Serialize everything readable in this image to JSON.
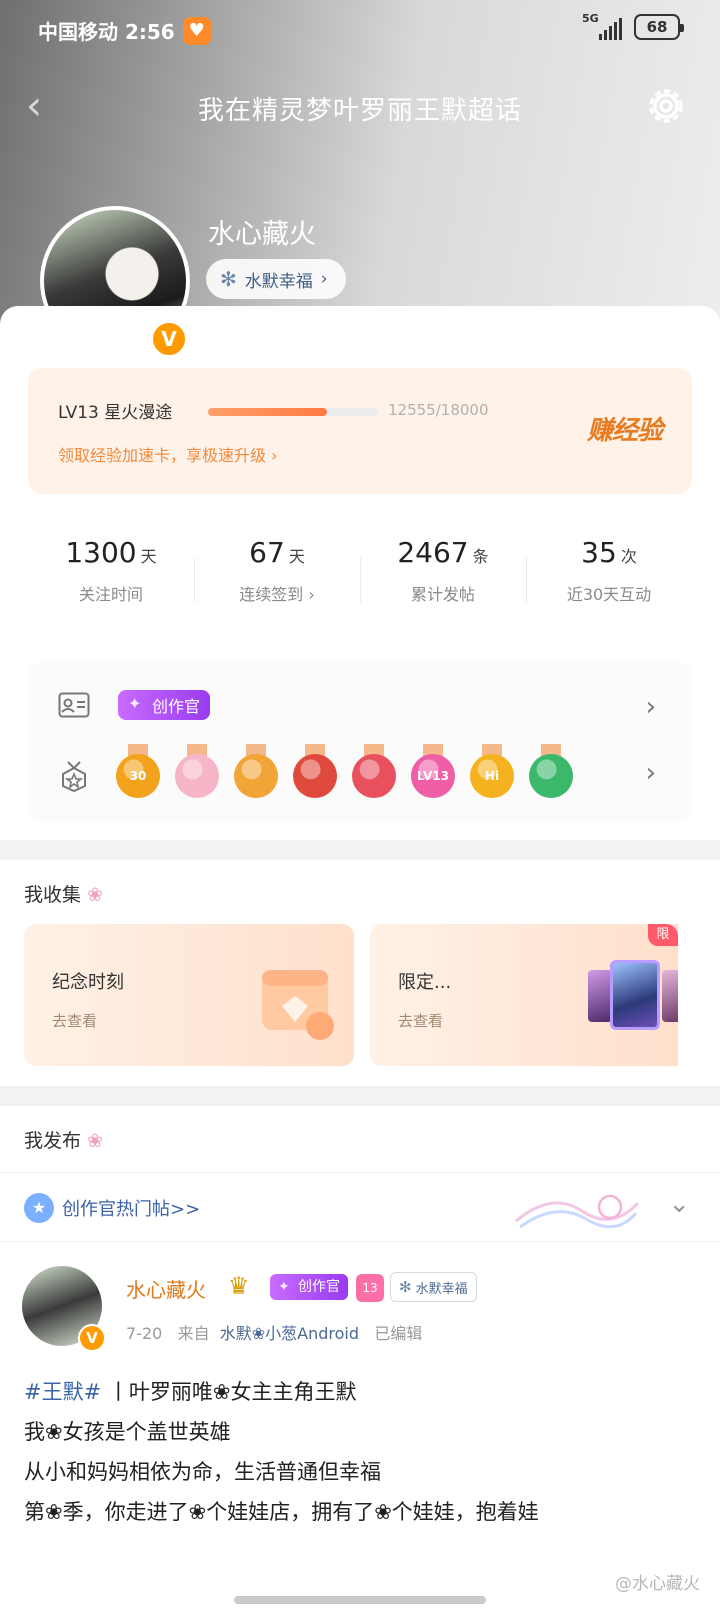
{
  "status": {
    "carrier_time": "中国移动 2:56",
    "network": "5G",
    "battery": "68"
  },
  "header": {
    "title": "我在精灵梦叶罗丽王默超话"
  },
  "profile": {
    "name": "水心藏火",
    "group": "水默幸福",
    "verified": "V"
  },
  "level": {
    "label": "LV13 星火漫途",
    "progress_text": "12555/18000",
    "progress_fraction": 0.6975,
    "hint": "领取经验加速卡，享极速升级",
    "earn": "赚经验"
  },
  "stats": [
    {
      "num": "1300",
      "unit": "天",
      "label": "关注时间"
    },
    {
      "num": "67",
      "unit": "天",
      "label": "连续签到"
    },
    {
      "num": "2467",
      "unit": "条",
      "label": "累计发帖"
    },
    {
      "num": "35",
      "unit": "次",
      "label": "近30天互动"
    }
  ],
  "badges": {
    "creator_tag": "创作官",
    "medals": [
      {
        "icon": "30-days-medal",
        "text": "30",
        "color": "#f2a21b"
      },
      {
        "icon": "sakura-medal",
        "text": "",
        "color": "#f6b6c8"
      },
      {
        "icon": "crown-medal",
        "text": "",
        "color": "#f2a436"
      },
      {
        "icon": "cat-medal-red",
        "text": "",
        "color": "#e04a3c"
      },
      {
        "icon": "cat-medal-pink",
        "text": "",
        "color": "#e8505e"
      },
      {
        "icon": "lv13-medal",
        "text": "LV13",
        "color": "#f05ea7"
      },
      {
        "icon": "hi-medal",
        "text": "Hi",
        "color": "#f6b21e"
      },
      {
        "icon": "hand-medal",
        "text": "",
        "color": "#3bb86a"
      }
    ]
  },
  "collection": {
    "title": "我收集",
    "cards": [
      {
        "name": "纪念时刻",
        "go": "去查看"
      },
      {
        "name": "限定...",
        "go": "去查看",
        "tag": "限"
      }
    ]
  },
  "posts": {
    "title": "我发布",
    "hot_label": "创作官热门帖>>",
    "post": {
      "author": "水心藏火",
      "creator_tag": "创作官",
      "level": "13",
      "group": "水默幸福",
      "date": "7-20",
      "from_label": "来自",
      "source": "水默❀小葱Android",
      "edited": "已编辑",
      "hashtag": "#王默#",
      "lines": [
        "丨叶罗丽唯❀女主主角王默",
        "我❀女孩是个盖世英雄",
        "从小和妈妈相依为命，生活普通但幸福",
        "第❀季，你走进了❀个娃娃店，拥有了❀个娃娃，抱着娃"
      ]
    },
    "watermark": "@水心藏火"
  }
}
